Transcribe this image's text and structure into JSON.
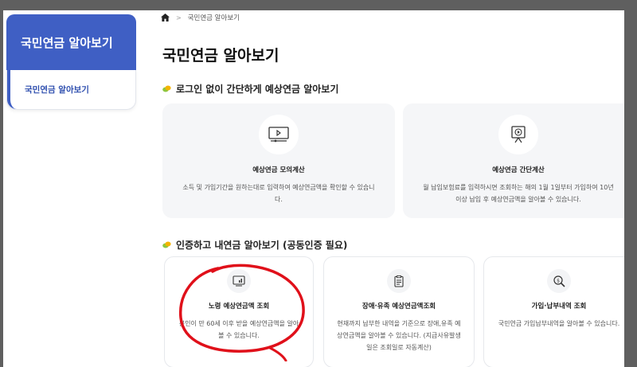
{
  "sidebar": {
    "title": "국민연금 알아보기",
    "items": [
      {
        "label": "국민연금 알아보기"
      }
    ]
  },
  "breadcrumb": {
    "current": "국민연금 알아보기"
  },
  "page_title": "국민연금 알아보기",
  "section1": {
    "title": "로그인 없이 간단하게 예상연금 알아보기",
    "cards": [
      {
        "icon": "video-screen-icon",
        "title": "예상연금 모의계산",
        "desc": "소득 및 가입기간을 원하는대로 입력하여 예상연금액을 확인할 수 있습니다."
      },
      {
        "icon": "monitor-play-icon",
        "title": "예상연금 간단계산",
        "desc": "월 납입보험료를 입력하시면 조회하는 해의 1월 1일부터 가입하여 10년 이상 납입 후 예상연금액을 알아볼 수 있습니다."
      }
    ]
  },
  "section2": {
    "title": "인증하고 내연금 알아보기 (공동인증 필요)",
    "cards": [
      {
        "icon": "chart-monitor-icon",
        "title": "노령 예상연금액 조회",
        "desc": "본인이 만 60세 이후 받을 예상연금액을 알아볼 수 있습니다."
      },
      {
        "icon": "document-icon",
        "title": "장애·유족 예상연금액조회",
        "desc": "현재까지 납부한 내역을 기준으로 장애,유족 예상연금액을 알아볼 수 있습니다. (지급사유발생일은 조회일로 자동계산)"
      },
      {
        "icon": "coin-search-icon",
        "title": "가입·납부내역 조회",
        "desc": "국민연금 가입납부내역을 알아볼 수 있습니다."
      }
    ]
  },
  "colors": {
    "accent": "#3f5fc4",
    "annotation": "#e0101a"
  }
}
